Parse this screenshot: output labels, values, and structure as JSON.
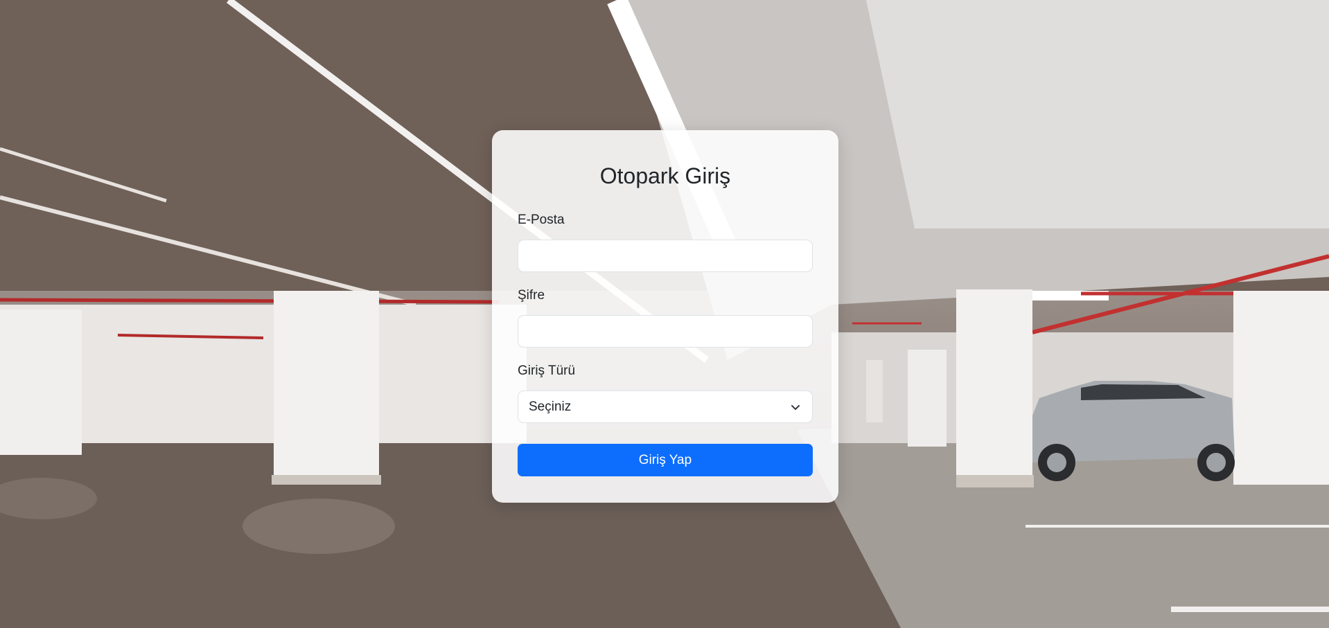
{
  "login": {
    "title": "Otopark Giriş",
    "email_label": "E-Posta",
    "email_value": "",
    "password_label": "Şifre",
    "password_value": "",
    "login_type_label": "Giriş Türü",
    "login_type_selected": "Seçiniz",
    "submit_label": "Giriş Yap"
  },
  "colors": {
    "primary": "#0d6efd",
    "card_background": "#ffffff",
    "text": "#212529"
  }
}
